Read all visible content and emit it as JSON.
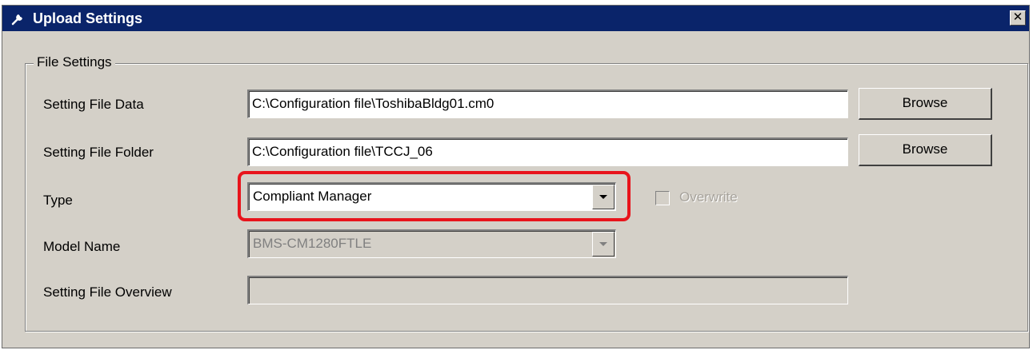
{
  "window": {
    "title": "Upload Settings",
    "close_glyph": "✕"
  },
  "group": {
    "legend": "File Settings"
  },
  "fields": {
    "setting_file_data": {
      "label": "Setting File Data",
      "value": "C:\\Configuration file\\ToshibaBldg01.cm0",
      "button_label": "Browse"
    },
    "setting_file_folder": {
      "label": "Setting File Folder",
      "value": "C:\\Configuration file\\TCCJ_06",
      "button_label": "Browse"
    },
    "type": {
      "label": "Type",
      "value": "Compliant Manager"
    },
    "overwrite": {
      "label": "Overwrite",
      "checked": false,
      "enabled": false
    },
    "model_name": {
      "label": "Model Name",
      "value": "BMS-CM1280FTLE",
      "enabled": false
    },
    "setting_file_overview": {
      "label": "Setting File Overview",
      "value": ""
    }
  },
  "colors": {
    "title_bar": "#0a246a",
    "dialog_face": "#d4d0c8",
    "highlight": "#e8141c"
  },
  "icons": {
    "title": "wrench-icon",
    "close": "close-icon",
    "dropdown": "chevron-down-icon"
  }
}
